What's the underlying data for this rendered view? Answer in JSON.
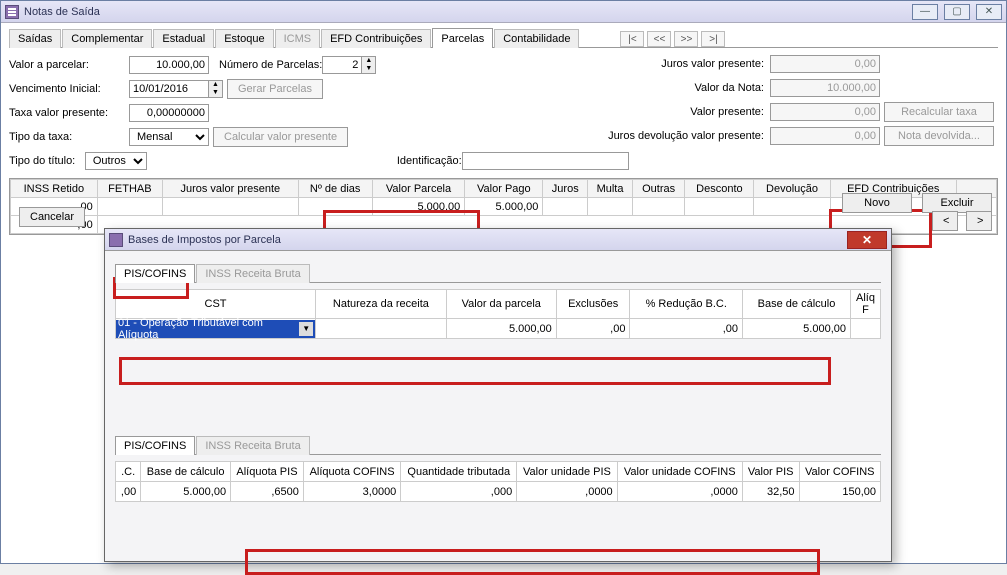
{
  "window": {
    "title": "Notas de Saída"
  },
  "tabs": [
    "Saídas",
    "Complementar",
    "Estadual",
    "Estoque",
    "ICMS",
    "EFD Contribuições",
    "Parcelas",
    "Contabilidade"
  ],
  "nav": {
    "first": "|<",
    "prev": "<<",
    "next": ">>",
    "last": ">|"
  },
  "form": {
    "valor_a_parcelar_lbl": "Valor a parcelar:",
    "valor_a_parcelar": "10.000,00",
    "num_parcelas_lbl": "Número de Parcelas:",
    "num_parcelas": "2",
    "venc_inicial_lbl": "Vencimento Inicial:",
    "venc_inicial": "10/01/2016",
    "gerar_parcelas": "Gerar Parcelas",
    "taxa_lbl": "Taxa valor presente:",
    "taxa": "0,00000000",
    "tipo_taxa_lbl": "Tipo da taxa:",
    "tipo_taxa": "Mensal",
    "calc_vp": "Calcular valor presente",
    "tipo_titulo_lbl": "Tipo do título:",
    "tipo_titulo": "Outros",
    "identificacao_lbl": "Identificação:"
  },
  "right": {
    "juros_vp_lbl": "Juros valor presente:",
    "juros_vp": "0,00",
    "valor_nota_lbl": "Valor da Nota:",
    "valor_nota": "10.000,00",
    "vp_lbl": "Valor presente:",
    "vp": "0,00",
    "juros_dev_lbl": "Juros devolução valor presente:",
    "juros_dev": "0,00",
    "recalc": "Recalcular taxa",
    "nota_dev": "Nota devolvida..."
  },
  "grid_cols": [
    "INSS Retido",
    "FETHAB",
    "Juros valor presente",
    "Nº de dias",
    "Valor Parcela",
    "Valor Pago",
    "Juros",
    "Multa",
    "Outras",
    "Desconto",
    "Devolução",
    "EFD Contribuições"
  ],
  "grid_row": {
    "inss": ",00",
    "fethab": "",
    "jvp": "",
    "dias": "",
    "vparc": "5.000,00",
    "vpago": "5.000,00",
    "juros": "",
    "multa": "",
    "outras": "",
    "desc": "",
    "dev": "",
    "efd": "..."
  },
  "grid_row2": {
    "inss": ",00"
  },
  "dialog": {
    "title": "Bases de Impostos por Parcela",
    "tab1": "PIS/COFINS",
    "tab2": "INSS Receita Bruta",
    "g_cols": [
      "CST",
      "Natureza da receita",
      "Valor da parcela",
      "Exclusões",
      "% Redução B.C.",
      "Base de cálculo",
      "Alíq F"
    ],
    "cst_sel": "01 - Operação Tributável com Alíquota",
    "g_row": {
      "nat": "",
      "vparc": "5.000,00",
      "excl": ",00",
      "red": ",00",
      "base": "5.000,00"
    },
    "g2_cols": [
      ".C.",
      "Base de cálculo",
      "Alíquota PIS",
      "Alíquota COFINS",
      "Quantidade tributada",
      "Valor unidade PIS",
      "Valor unidade COFINS",
      "Valor PIS",
      "Valor COFINS"
    ],
    "g2_row": {
      "c": ",00",
      "base": "5.000,00",
      "apis": ",6500",
      "acof": "3,0000",
      "qt": ",000",
      "vupis": ",0000",
      "vucof": ",0000",
      "vpis": "32,50",
      "vcof": "150,00"
    }
  },
  "buttons": {
    "excluir": "Excluir",
    "novo": "Novo",
    "cancelar": "Cancelar",
    "prev": "<",
    "next": ">"
  }
}
